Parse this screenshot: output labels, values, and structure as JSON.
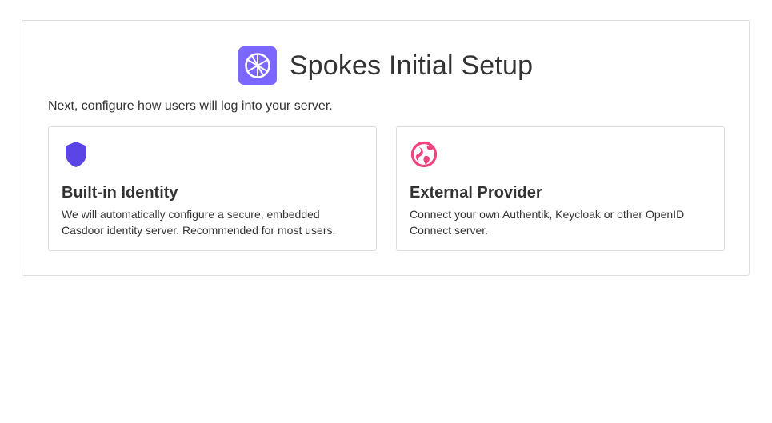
{
  "header": {
    "title": "Spokes Initial Setup",
    "logo_icon": "wheel-icon",
    "logo_color": "#7b66ff"
  },
  "subtitle": "Next, configure how users will log into your server.",
  "options": [
    {
      "title": "Built-in Identity",
      "description": "We will automatically configure a secure, embedded Casdoor identity server. Recommended for most users.",
      "icon": "shield-icon",
      "icon_color": "#5b45e6"
    },
    {
      "title": "External Provider",
      "description": "Connect your own Authentik, Keycloak or other OpenID Connect server.",
      "icon": "globe-icon",
      "icon_color": "#f0437f"
    }
  ]
}
